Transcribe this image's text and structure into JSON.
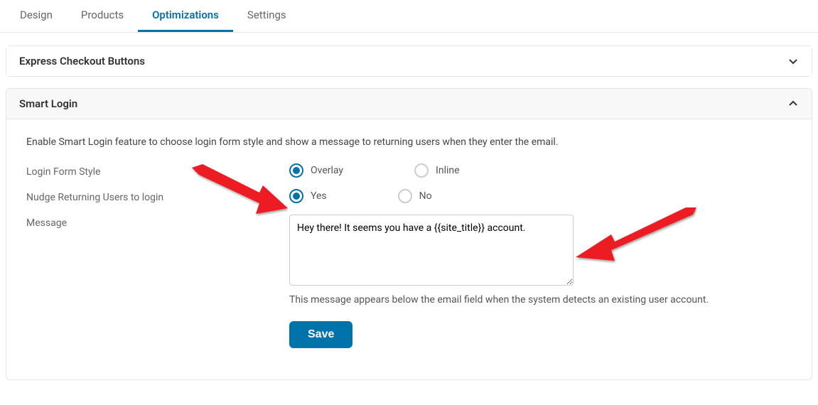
{
  "tabs": {
    "design": "Design",
    "products": "Products",
    "optimizations": "Optimizations",
    "settings": "Settings"
  },
  "panels": {
    "express_checkout": {
      "title": "Express Checkout Buttons"
    },
    "smart_login": {
      "title": "Smart Login",
      "description": "Enable Smart Login feature to choose login form style and show a message to returning users when they enter the email.",
      "fields": {
        "login_form_style": {
          "label": "Login Form Style",
          "options": {
            "overlay": "Overlay",
            "inline": "Inline"
          }
        },
        "nudge_returning": {
          "label": "Nudge Returning Users to login",
          "options": {
            "yes": "Yes",
            "no": "No"
          }
        },
        "message": {
          "label": "Message",
          "value": "Hey there! It seems you have a {{site_title}} account.",
          "helper": "This message appears below the email field when the system detects an existing user account."
        }
      },
      "save_button": "Save"
    }
  }
}
